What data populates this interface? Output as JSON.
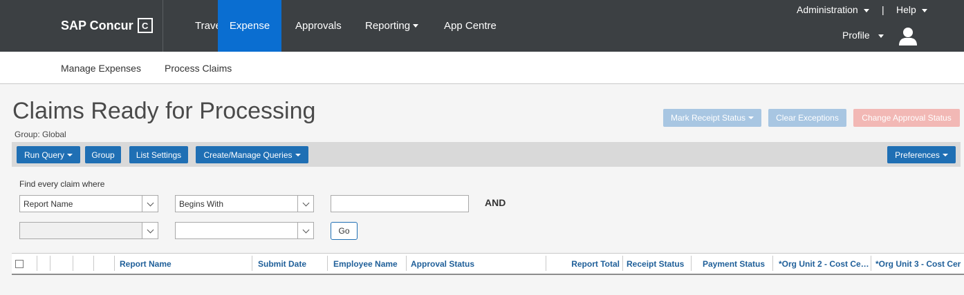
{
  "topnav": {
    "brand": "SAP Concur",
    "brand_mark": "C",
    "items": [
      {
        "label": "Travel"
      },
      {
        "label": "Expense"
      },
      {
        "label": "Approvals"
      },
      {
        "label": "Reporting"
      },
      {
        "label": "App Centre"
      }
    ],
    "active_item": "Expense",
    "administration": "Administration",
    "help": "Help",
    "separator": "|",
    "profile": "Profile"
  },
  "subnav": {
    "items": [
      {
        "label": "Manage Expenses"
      },
      {
        "label": "Process Claims"
      }
    ],
    "active_item": "Process Claims"
  },
  "page": {
    "title": "Claims Ready for Processing",
    "group": "Group: Global"
  },
  "actions": {
    "mark_receipt_status": "Mark Receipt Status",
    "clear_exceptions": "Clear Exceptions",
    "change_approval_status": "Change Approval Status"
  },
  "toolbar": {
    "run_query": "Run Query",
    "group": "Group",
    "list_settings": "List Settings",
    "create_manage_queries": "Create/Manage Queries",
    "preferences": "Preferences"
  },
  "query": {
    "find_label": "Find every claim where",
    "field1": "Report Name",
    "operator1": "Begins With",
    "value1": "",
    "and_label": "AND",
    "field2": "",
    "operator2": "",
    "go": "Go"
  },
  "table": {
    "columns": [
      "Report Name",
      "Submit Date",
      "Employee Name",
      "Approval Status",
      "Report Total",
      "Receipt Status",
      "Payment Status",
      "*Org Unit 2 - Cost Ce…",
      "*Org Unit 3 - Cost Cer"
    ]
  },
  "colors": {
    "topbar": "#3c4043",
    "accent": "#0a6ed1",
    "button": "#1f6fb4",
    "link": "#1f5f99"
  },
  "icons": [
    "caret-down-icon",
    "user-avatar-icon",
    "chevron-down-icon",
    "checkbox-icon"
  ]
}
